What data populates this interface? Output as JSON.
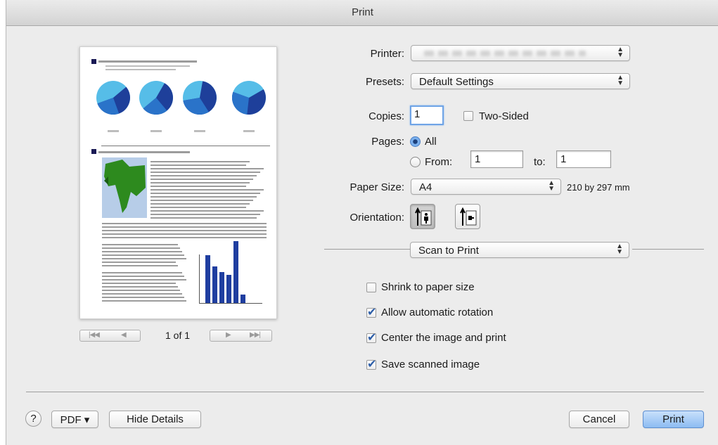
{
  "window": {
    "title": "Print"
  },
  "preview": {
    "page_indicator": "1 of 1",
    "pie_colors": {
      "dark": "#1e3f9a",
      "mid": "#2a73c9",
      "light": "#56bde8"
    },
    "map_colors": {
      "land": "#2d8a1e",
      "sea": "#b7cde8"
    },
    "bar_color": "#1f3ea0",
    "bar_values": [
      68,
      52,
      44,
      40,
      88,
      12
    ]
  },
  "form": {
    "printer": {
      "label": "Printer:",
      "value": ""
    },
    "presets": {
      "label": "Presets:",
      "value": "Default Settings"
    },
    "copies": {
      "label": "Copies:",
      "value": "1",
      "two_sided_label": "Two-Sided",
      "two_sided_checked": false
    },
    "pages": {
      "label": "Pages:",
      "all_label": "All",
      "all_selected": true,
      "from_label": "From:",
      "from_value": "1",
      "to_label": "to:",
      "to_value": "1"
    },
    "paper_size": {
      "label": "Paper Size:",
      "value": "A4",
      "dimensions": "210 by 297 mm"
    },
    "orientation": {
      "label": "Orientation:",
      "selected": "portrait"
    },
    "section_popup": {
      "value": "Scan to Print"
    },
    "options": [
      {
        "label": "Shrink to paper size",
        "checked": false
      },
      {
        "label": "Allow automatic rotation",
        "checked": true
      },
      {
        "label": "Center the image and print",
        "checked": true
      },
      {
        "label": "Save scanned image",
        "checked": true
      }
    ]
  },
  "footer": {
    "help_label": "?",
    "pdf_label": "PDF ▾",
    "hide_details_label": "Hide Details",
    "cancel_label": "Cancel",
    "print_label": "Print"
  }
}
